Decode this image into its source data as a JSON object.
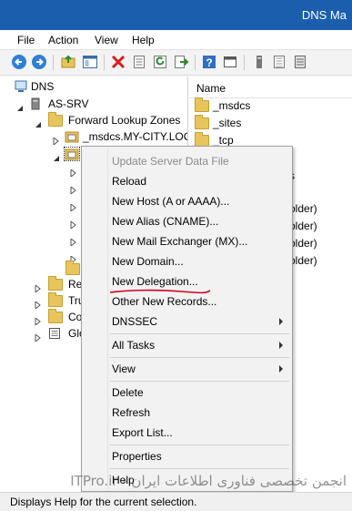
{
  "window": {
    "title": "DNS Ma"
  },
  "menubar": {
    "items": [
      "File",
      "Action",
      "View",
      "Help"
    ]
  },
  "toolbar": {
    "buttons": [
      "back-icon",
      "forward-icon",
      "up-folder-icon",
      "show-hide-tree-icon",
      "delete-icon",
      "properties-icon",
      "refresh-icon",
      "export-icon",
      "help-icon",
      "console-icon",
      "host-icon",
      "zone-icon",
      "server-icon"
    ]
  },
  "tree": {
    "root": "DNS",
    "server": "AS-SRV",
    "forward_zones": "Forward Lookup Zones",
    "msdcs_zone": "_msdcs.MY-CITY.LOC",
    "other_partials": [
      "Rev",
      "Tru",
      "Co",
      "Glo"
    ]
  },
  "list": {
    "column_header": "Name",
    "rows": [
      "_msdcs",
      "_sites",
      "_tcp"
    ],
    "partial_rows": [
      "s",
      "older)",
      "older)",
      "older)",
      "older)"
    ]
  },
  "context_menu": {
    "items": [
      {
        "label": "Update Server Data File",
        "enabled": false
      },
      {
        "label": "Reload",
        "enabled": true
      },
      {
        "label": "New Host (A or AAAA)...",
        "enabled": true
      },
      {
        "label": "New Alias (CNAME)...",
        "enabled": true
      },
      {
        "label": "New Mail Exchanger (MX)...",
        "enabled": true
      },
      {
        "label": "New Domain...",
        "enabled": true
      },
      {
        "label": "New Delegation...",
        "enabled": true
      },
      {
        "label": "Other New Records...",
        "enabled": true
      },
      {
        "label": "DNSSEC",
        "enabled": true,
        "submenu": true
      },
      {
        "label": "All Tasks",
        "enabled": true,
        "submenu": true
      },
      {
        "label": "View",
        "enabled": true,
        "submenu": true
      },
      {
        "label": "Delete",
        "enabled": true
      },
      {
        "label": "Refresh",
        "enabled": true
      },
      {
        "label": "Export List...",
        "enabled": true
      },
      {
        "label": "Properties",
        "enabled": true
      },
      {
        "label": "Help",
        "enabled": true
      }
    ]
  },
  "statusbar": {
    "text": "Displays Help for the current selection."
  },
  "watermark": {
    "text": "انجمن تخصصی فناوری اطلاعات ایران - ITPro.ir"
  },
  "colors": {
    "titlebar": "#1b5ead",
    "folder": "#e8c45c",
    "annotation": "#d0021b"
  }
}
